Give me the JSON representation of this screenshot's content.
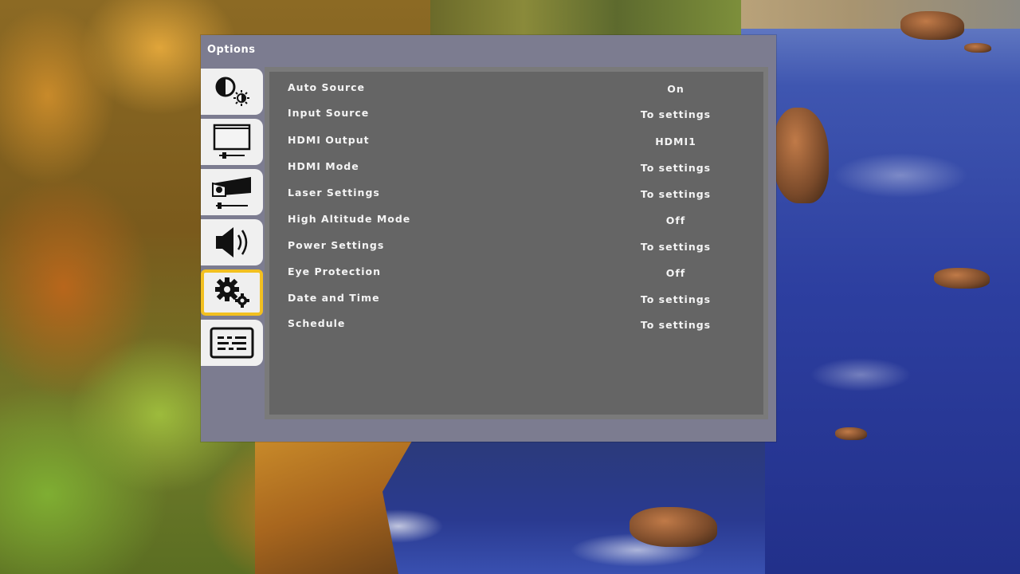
{
  "window": {
    "title": "Options"
  },
  "tabs": [
    {
      "id": "picture",
      "icon": "contrast-brightness-icon",
      "selected": false
    },
    {
      "id": "screen",
      "icon": "screen-projection-icon",
      "selected": false
    },
    {
      "id": "installation",
      "icon": "projector-setup-icon",
      "selected": false
    },
    {
      "id": "audio",
      "icon": "speaker-volume-icon",
      "selected": false
    },
    {
      "id": "options",
      "icon": "gears-icon",
      "selected": true
    },
    {
      "id": "information",
      "icon": "info-panel-icon",
      "selected": false
    }
  ],
  "accent_color": "#f2c020",
  "menu": {
    "items": [
      {
        "label": "Auto Source",
        "value": "On"
      },
      {
        "label": "Input Source",
        "value": "To settings"
      },
      {
        "label": "HDMI Output",
        "value": "HDMI1"
      },
      {
        "label": "HDMI Mode",
        "value": "To settings"
      },
      {
        "label": "Laser Settings",
        "value": "To settings"
      },
      {
        "label": "High Altitude Mode",
        "value": "Off"
      },
      {
        "label": "Power Settings",
        "value": "To settings"
      },
      {
        "label": "Eye Protection",
        "value": "Off"
      },
      {
        "label": "Date and Time",
        "value": "To settings"
      },
      {
        "label": "Schedule",
        "value": "To settings"
      }
    ]
  }
}
